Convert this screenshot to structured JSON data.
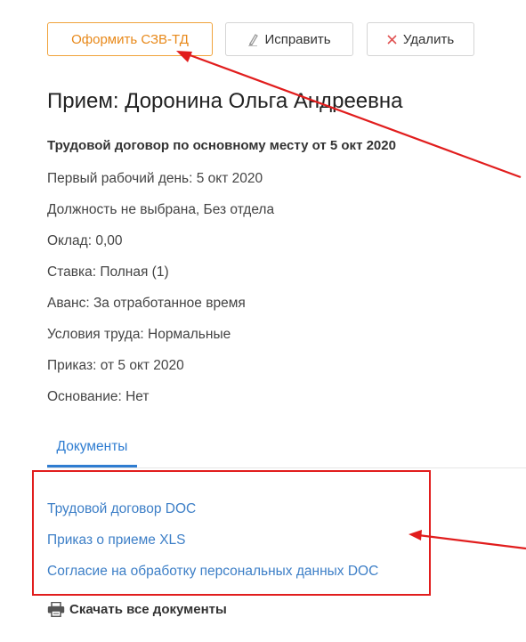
{
  "toolbar": {
    "primary_label": "Оформить СЗВ-ТД",
    "edit_label": "Исправить",
    "delete_label": "Удалить",
    "edit_icon": "pencil-icon",
    "delete_icon": "close-icon"
  },
  "record": {
    "title": "Прием: Доронина Ольга Андреевна",
    "subtitle": "Трудовой договор по основному месту от 5 окт 2020",
    "details": [
      "Первый рабочий день: 5 окт 2020",
      "Должность не выбрана, Без отдела",
      "Оклад: 0,00",
      "Ставка: Полная (1)",
      "Аванс: За отработанное время",
      "Условия труда: Нормальные",
      "Приказ: от 5 окт 2020",
      "Основание: Нет"
    ]
  },
  "tabs": {
    "documents_label": "Документы"
  },
  "documents": [
    "Трудовой договор DOC",
    "Приказ о приеме XLS",
    "Согласие на обработку персональных данных DOC"
  ],
  "download": {
    "label": "Скачать все документы",
    "icon": "printer-icon"
  },
  "colors": {
    "accent_orange": "#e8891a",
    "link_blue": "#3d7fc7",
    "annotation_red": "#e11d1d"
  }
}
